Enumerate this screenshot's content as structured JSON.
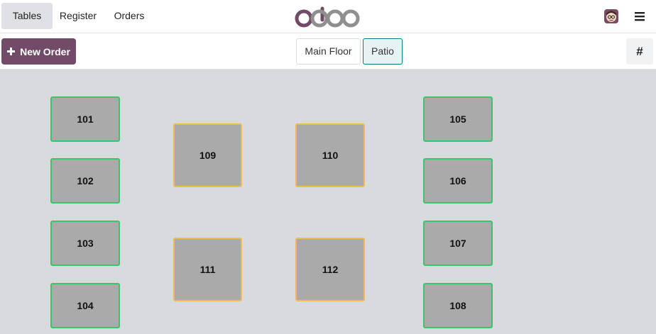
{
  "nav": {
    "tabs": [
      {
        "label": "Tables"
      },
      {
        "label": "Register"
      },
      {
        "label": "Orders"
      }
    ],
    "logo_text": "odoo"
  },
  "toolbar": {
    "new_order_label": "New Order",
    "floors": [
      {
        "label": "Main Floor",
        "active": false
      },
      {
        "label": "Patio",
        "active": true
      }
    ],
    "hash_label": "#"
  },
  "colors": {
    "brand": "#714b67",
    "table_available": "#3cc36b",
    "table_occupied": "#f0b95a",
    "floor_bg": "#d9dadd",
    "active_floor": "#017e84"
  },
  "tables": [
    {
      "name": "101",
      "status": "available"
    },
    {
      "name": "102",
      "status": "available"
    },
    {
      "name": "103",
      "status": "available"
    },
    {
      "name": "104",
      "status": "available"
    },
    {
      "name": "105",
      "status": "available"
    },
    {
      "name": "106",
      "status": "available"
    },
    {
      "name": "107",
      "status": "available"
    },
    {
      "name": "108",
      "status": "available"
    },
    {
      "name": "109",
      "status": "occupied"
    },
    {
      "name": "110",
      "status": "occupied"
    },
    {
      "name": "111",
      "status": "occupied"
    },
    {
      "name": "112",
      "status": "occupied"
    }
  ],
  "icons": {
    "new_order": "plus-icon",
    "user": "avatar-icon",
    "menu": "hamburger-menu-icon"
  }
}
